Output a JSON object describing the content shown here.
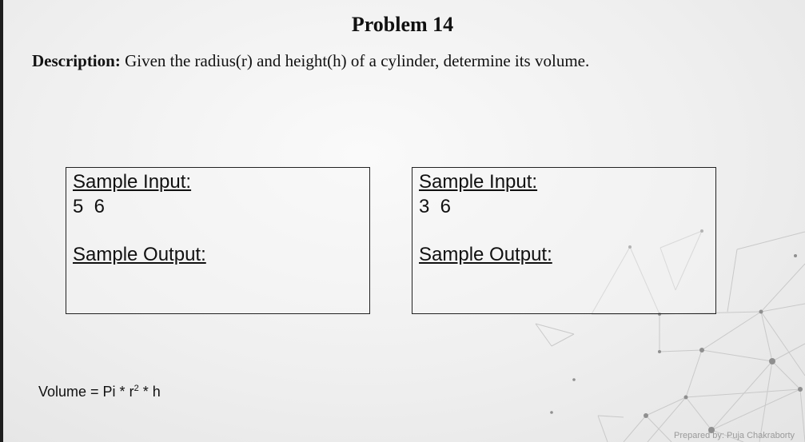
{
  "slide": {
    "title": "Problem 14",
    "description_label": "Description:",
    "description_text": " Given the radius(r) and height(h) of a cylinder, determine its volume.",
    "samples": [
      {
        "input_label": "Sample Input:",
        "input_value": "5  6",
        "output_label": "Sample Output:"
      },
      {
        "input_label": "Sample Input:",
        "input_value": "3  6",
        "output_label": "Sample Output:"
      }
    ],
    "formula": {
      "prefix": "Volume = Pi * r",
      "exponent": "2",
      "suffix": "  * h"
    },
    "credit": "Prepared by: Puja Chakraborty"
  }
}
